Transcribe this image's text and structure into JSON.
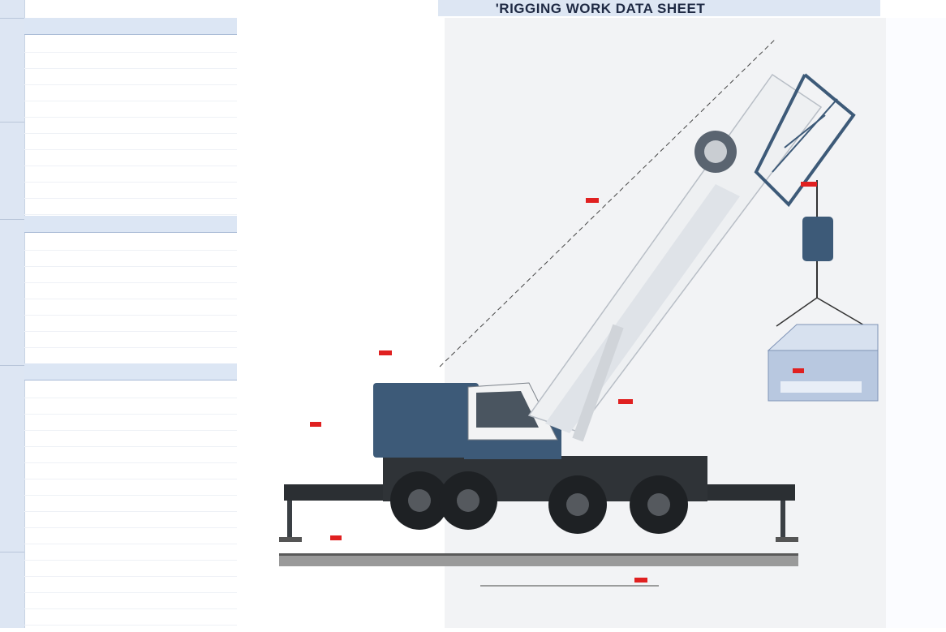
{
  "sheet": {
    "title": "'RIGGING WORK DATA SHEET"
  },
  "colors": {
    "header_blue": "#dce6f4",
    "crane_blue": "#3d5a78",
    "boom_white": "#eef0f2",
    "label_red": "#e02020",
    "text_blue": "#3a50a8"
  }
}
